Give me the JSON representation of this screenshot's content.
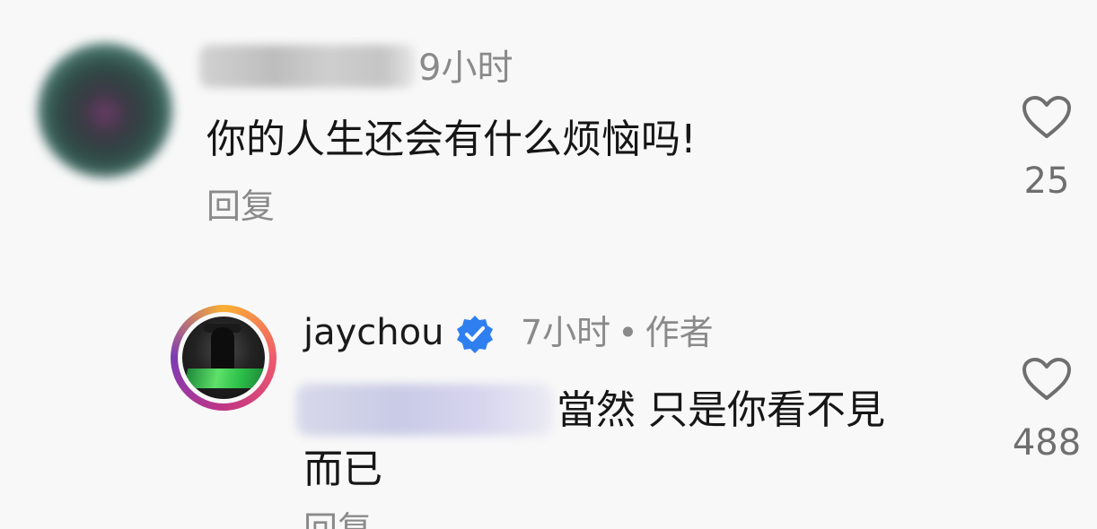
{
  "comments": [
    {
      "time": "9小时",
      "text": "你的人生还会有什么烦恼吗!",
      "reply_label": "回复",
      "like_count": "25"
    },
    {
      "username": "jaychou",
      "verified": true,
      "time": "7小时",
      "separator": "•",
      "author_tag": "作者",
      "text_line1": "當然 只是你看不見",
      "text_line2": "而已",
      "reply_label": "回复",
      "like_count": "488"
    }
  ],
  "icons": {
    "like": "heart-outline-icon",
    "verified": "verified-badge-icon"
  },
  "colors": {
    "verified_blue": "#2f7ff0",
    "muted_text": "#8a8a8a"
  }
}
